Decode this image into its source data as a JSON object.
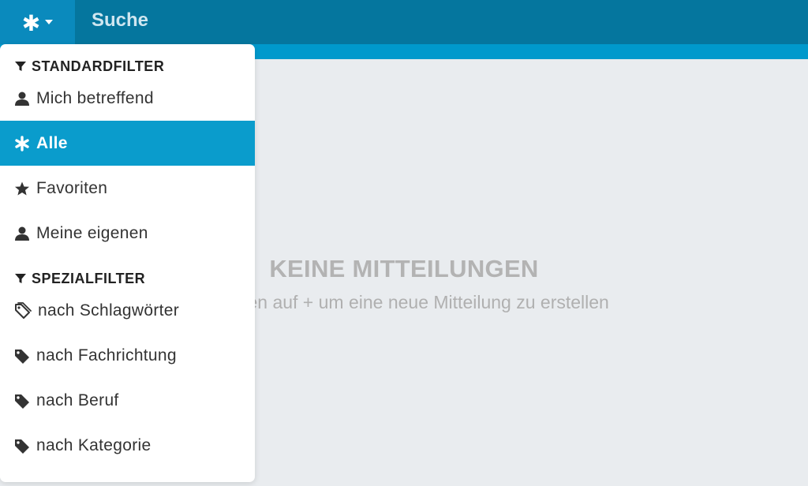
{
  "topbar": {
    "filter_toggle_glyph": "✱",
    "search_label": "Suche"
  },
  "empty_state": {
    "title": "KEINE MITTEILUNGEN",
    "hint": "s oben auf + um eine neue Mitteilung zu erstellen"
  },
  "dropdown": {
    "standard_header": "STANDARDFILTER",
    "special_header": "SPEZIALFILTER",
    "standard_items": [
      {
        "label": "Mich betreffend",
        "icon": "user-icon"
      },
      {
        "label": "Alle",
        "icon": "asterisk-icon",
        "active": true
      },
      {
        "label": "Favoriten",
        "icon": "star-icon"
      },
      {
        "label": "Meine eigenen",
        "icon": "user-icon"
      }
    ],
    "special_items": [
      {
        "label": "nach Schlagwörter",
        "icon": "tags-icon"
      },
      {
        "label": "nach Fachrichtung",
        "icon": "tag-icon"
      },
      {
        "label": "nach Beruf",
        "icon": "tag-icon"
      },
      {
        "label": "nach Kategorie",
        "icon": "tag-icon"
      }
    ]
  },
  "colors": {
    "topbar": "#05769e",
    "subbar": "#0099cc",
    "active_item": "#0a9ccc",
    "background": "#e9ecef"
  }
}
